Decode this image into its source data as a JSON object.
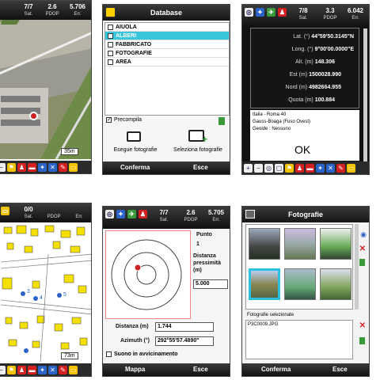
{
  "screen1": {
    "status": {
      "sat": "7/7",
      "sat_label": "Sat.",
      "pdop": "2.6",
      "pdop_label": "PDOP",
      "err": "5.706",
      "err_label": "Err."
    },
    "scale": "35m"
  },
  "screen2": {
    "title": "Database",
    "items": [
      "AIUOLA",
      "ALBERI",
      "FABBRICATO",
      "FOTOGRAFIE",
      "AREA"
    ],
    "precompila": "Precompila",
    "exec_photo": "Esegue fotografie",
    "select_photo": "Seleziona fotografie",
    "confirm": "Conferma",
    "exit": "Esce"
  },
  "screen3": {
    "status": {
      "sat": "7/8",
      "sat_label": "Sat.",
      "pdop": "3.3",
      "pdop_label": "PDOP",
      "err": "6.042",
      "err_label": "Err."
    },
    "lat_label": "Lat. (°)",
    "lat": "44°59'50.3145\"N",
    "lon_label": "Long. (°)",
    "lon": "9°00'00.0000\"E",
    "alt_label": "Alt. (m)",
    "alt": "148.306",
    "est_label": "Est (m)",
    "est": "1500028.990",
    "nord_label": "Nord (m)",
    "nord": "4982664.955",
    "quota_label": "Quota (m)",
    "quota": "100.884",
    "datum": "Italia - Roma 40",
    "proj": "Gauss-Boaga (Fuso Ovest)",
    "geoid": "Geoide :   Nessuno",
    "ok": "OK"
  },
  "screen4": {
    "status": {
      "sat": "0/0",
      "sat_label": "Sat.",
      "pdop": "",
      "pdop_label": "PDOP",
      "err": "",
      "err_label": "Err."
    },
    "markers": [
      "3",
      "4",
      "5"
    ],
    "scale": "73m"
  },
  "screen5": {
    "status": {
      "sat": "7/7",
      "sat_label": "Sat.",
      "pdop": "2.6",
      "pdop_label": "PDOP",
      "err": "5.705",
      "err_label": "Err."
    },
    "punto_label": "Punto",
    "punto": "1",
    "dist_prox_label": "Distanza pressimità (m)",
    "dist_prox": "5.000",
    "distanza_label": "Distanza (m)",
    "distanza": "1.744",
    "azimuth_label": "Azimuth (°)",
    "azimuth": "292°55'57.4890\"",
    "suono": "Suono in avvicinamento",
    "map": "Mappa",
    "exit": "Esce"
  },
  "screen6": {
    "title": "Fotografie",
    "selected_label": "Fotografie selezionate",
    "selected_file": "P3C0009.JPG",
    "confirm": "Conferma",
    "exit": "Esce"
  }
}
